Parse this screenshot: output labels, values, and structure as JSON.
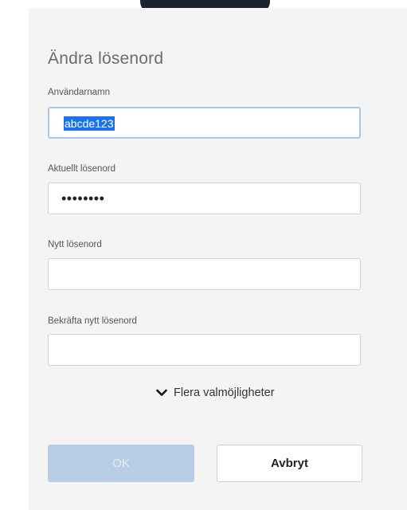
{
  "dialog": {
    "title": "Ändra lösenord",
    "fields": [
      {
        "label": "Användarnamn",
        "value": "abcde123"
      },
      {
        "label": "Aktuellt lösenord",
        "value": "••••••••"
      },
      {
        "label": "Nytt lösenord",
        "value": ""
      },
      {
        "label": "Bekräfta nytt lösenord",
        "value": ""
      }
    ],
    "more_options_label": "Flera valmöjligheter",
    "ok_label": "OK",
    "cancel_label": "Avbryt"
  },
  "colors": {
    "dialog_bg": "#f4f4f4",
    "selection": "#1a73e8",
    "ok_disabled_bg": "#b8cce6",
    "focus_border": "#a9c6e8"
  }
}
